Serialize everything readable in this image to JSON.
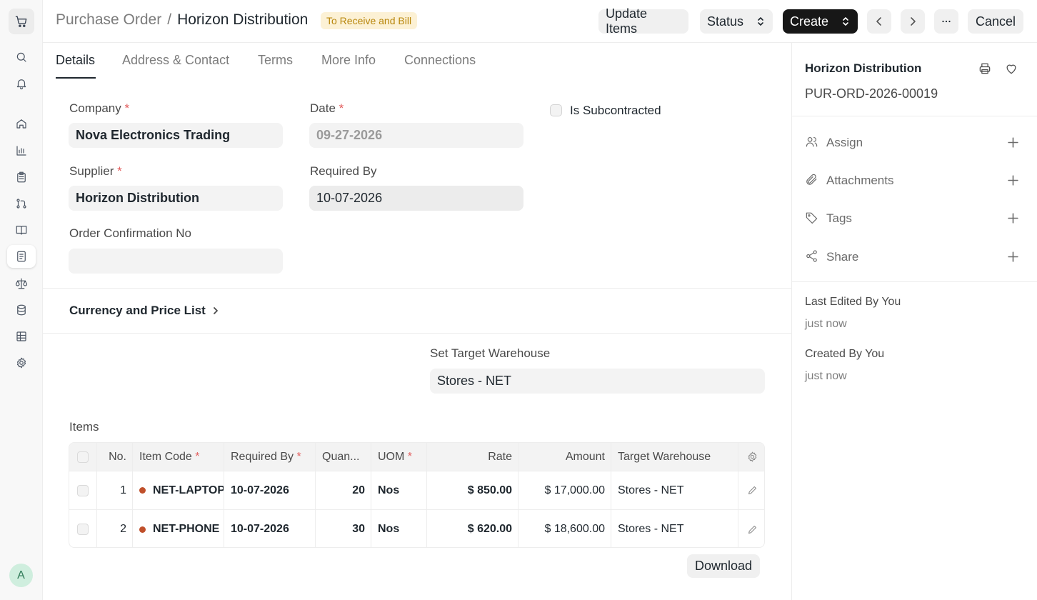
{
  "header": {
    "breadcrumb_parent": "Purchase Order",
    "breadcrumb_sep": "/",
    "title": "Horizon Distribution",
    "status_badge": "To Receive and Bill",
    "update_items_label": "Update Items",
    "status_label": "Status",
    "create_label": "Create",
    "cancel_label": "Cancel"
  },
  "tabs": [
    "Details",
    "Address & Contact",
    "Terms",
    "More Info",
    "Connections"
  ],
  "form": {
    "company_label": "Company",
    "company_value": "Nova Electronics Trading",
    "date_label": "Date",
    "date_value": "09-27-2026",
    "subcontracted_label": "Is Subcontracted",
    "supplier_label": "Supplier",
    "supplier_value": "Horizon Distribution",
    "required_by_label": "Required By",
    "required_by_value": "10-07-2026",
    "order_conf_label": "Order Confirmation No",
    "order_conf_value": "",
    "required_mark": "*",
    "currency_section": "Currency and Price List",
    "target_wh_label": "Set Target Warehouse",
    "target_wh_value": "Stores - NET",
    "items_label": "Items"
  },
  "items_table": {
    "columns": [
      "No.",
      "Item Code",
      "Required By",
      "Quan...",
      "UOM",
      "Rate",
      "Amount",
      "Target Warehouse"
    ],
    "rows": [
      {
        "no": "1",
        "item_code": "NET-LAPTOP",
        "required_by": "10-07-2026",
        "qty": "20",
        "uom": "Nos",
        "rate": "$ 850.00",
        "amount": "$ 17,000.00",
        "warehouse": "Stores - NET"
      },
      {
        "no": "2",
        "item_code": "NET-PHONE",
        "required_by": "10-07-2026",
        "qty": "30",
        "uom": "Nos",
        "rate": "$ 620.00",
        "amount": "$ 18,600.00",
        "warehouse": "Stores - NET"
      }
    ],
    "download_label": "Download"
  },
  "sidebar": {
    "title": "Horizon Distribution",
    "doc_id": "PUR-ORD-2026-00019",
    "items": [
      "Assign",
      "Attachments",
      "Tags",
      "Share"
    ],
    "last_edited_label": "Last Edited By You",
    "last_edited_value": "just now",
    "created_label": "Created By You",
    "created_value": "just now"
  },
  "user": {
    "avatar_initial": "A"
  },
  "colors": {
    "accent": "#171717",
    "badge_bg": "#fcf1d5",
    "badge_text": "#b8860b",
    "item_dot": "#c0502b",
    "required": "#e25c5c"
  }
}
